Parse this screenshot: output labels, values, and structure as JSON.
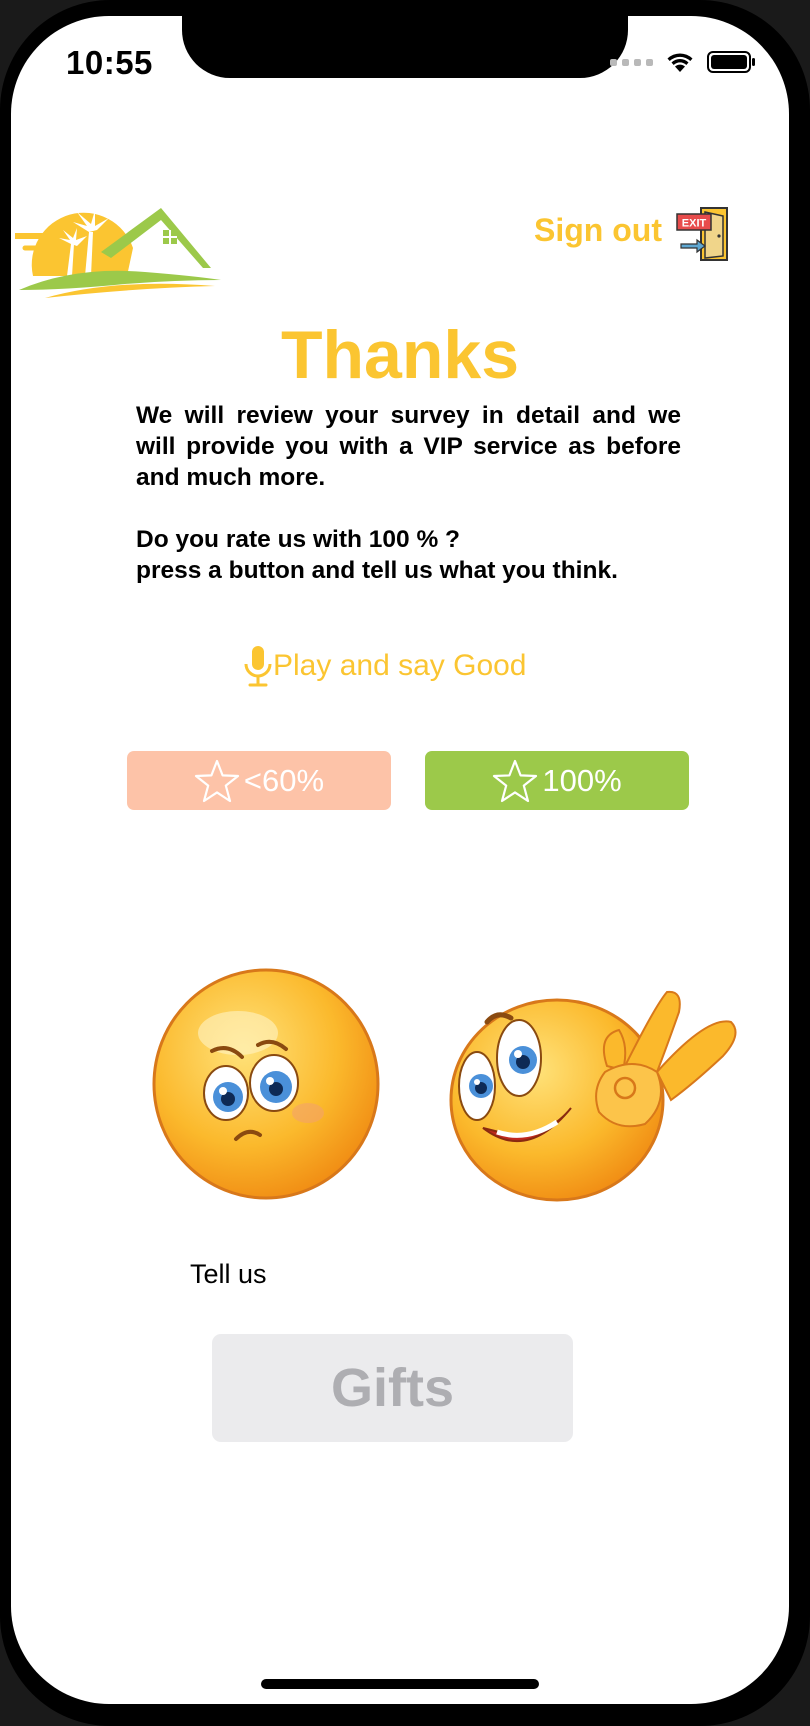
{
  "status_bar": {
    "time": "10:55"
  },
  "header": {
    "sign_out_label": "Sign out",
    "exit_sign_text": "EXIT"
  },
  "main": {
    "title": "Thanks",
    "message_line1": "We will review your survey in detail and we will provide you with a VIP service as before and much more.",
    "message_line2": "Do you rate us with 100 % ?",
    "message_line3": "press a button and tell us what you think.",
    "play_label": "Play and say Good"
  },
  "rating": {
    "low_label": "<60%",
    "high_label": "100%",
    "low_color": "#fdc3a8",
    "high_color": "#9cc94a"
  },
  "tell_us_label": "Tell us",
  "gifts_label": "Gifts",
  "colors": {
    "accent": "#fbc531"
  }
}
